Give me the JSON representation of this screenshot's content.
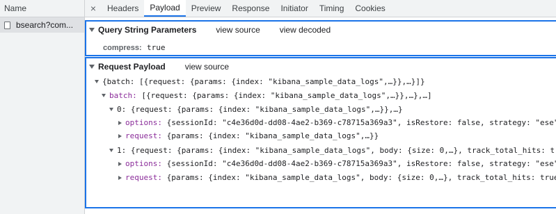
{
  "name_column": {
    "header": "Name",
    "request_name": "bsearch?com..."
  },
  "tabs": [
    "Headers",
    "Payload",
    "Preview",
    "Response",
    "Initiator",
    "Timing",
    "Cookies"
  ],
  "active_tab": "Payload",
  "query_string": {
    "title": "Query String Parameters",
    "view_source": "view source",
    "view_decoded": "view decoded",
    "param_key": "compress:",
    "param_value": "true"
  },
  "payload": {
    "title": "Request Payload",
    "view_source": "view source",
    "lines": [
      {
        "key": "",
        "text": "{batch: [{request: {params: {index: \"kibana_sample_data_logs\",…}},…}]}"
      },
      {
        "key": "batch:",
        "text": "[{request: {params: {index: \"kibana_sample_data_logs\",…}},…},…]"
      },
      {
        "key": "0:",
        "text": "{request: {params: {index: \"kibana_sample_data_logs\",…}},…}"
      },
      {
        "key": "options:",
        "text": "{sessionId: \"c4e36d0d-dd08-4ae2-b369-c78715a369a3\", isRestore: false, strategy: \"ese\""
      },
      {
        "key": "request:",
        "text": "{params: {index: \"kibana_sample_data_logs\",…}}"
      },
      {
        "key": "1:",
        "text": "{request: {params: {index: \"kibana_sample_data_logs\", body: {size: 0,…}, track_total_hits: t"
      },
      {
        "key": "options:",
        "text": "{sessionId: \"c4e36d0d-dd08-4ae2-b369-c78715a369a3\", isRestore: false, strategy: \"ese\""
      },
      {
        "key": "request:",
        "text": "{params: {index: \"kibana_sample_data_logs\", body: {size: 0,…}, track_total_hits: true"
      }
    ]
  },
  "colors": {
    "accent": "#1a73e8",
    "key_purple": "#8b2d9a"
  },
  "icons": {
    "close": "close-icon",
    "file": "file-icon"
  }
}
